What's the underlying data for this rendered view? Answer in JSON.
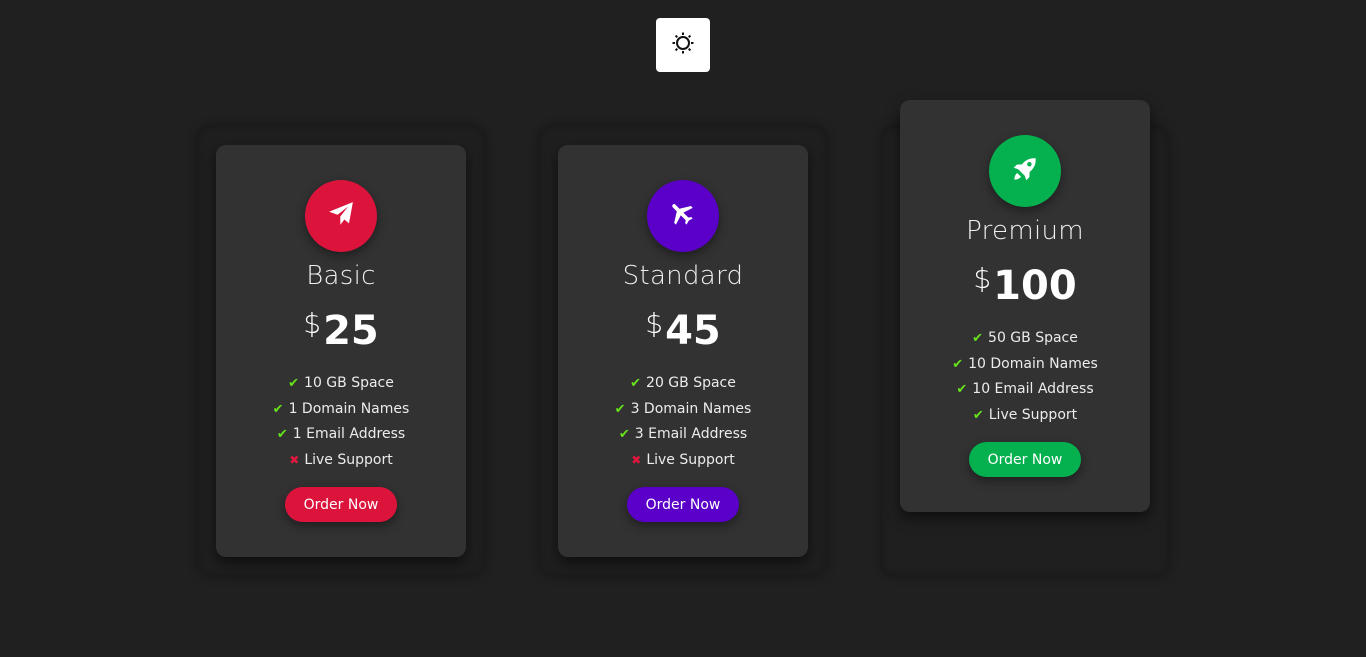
{
  "theme_toggle": {
    "icon": "sun-icon"
  },
  "colors": {
    "background": "#202020",
    "card": "#323232",
    "basic_accent": "#dc143c",
    "standard_accent": "#5a00c8",
    "premium_accent": "#05b14f",
    "check": "#66e31a",
    "cross": "#e0173e"
  },
  "plans": [
    {
      "name": "Basic",
      "currency": "$",
      "price": "25",
      "icon": "paper-plane-icon",
      "accent": "#dc143c",
      "button_label": "Order Now",
      "features": [
        {
          "text": "10 GB Space",
          "mark": "✔",
          "included": true
        },
        {
          "text": "1 Domain Names",
          "mark": "✔",
          "included": true
        },
        {
          "text": "1 Email Address",
          "mark": "✔",
          "included": true
        },
        {
          "text": "Live Support",
          "mark": "✖",
          "included": false
        }
      ]
    },
    {
      "name": "Standard",
      "currency": "$",
      "price": "45",
      "icon": "airplane-icon",
      "accent": "#5a00c8",
      "button_label": "Order Now",
      "features": [
        {
          "text": "20 GB Space",
          "mark": "✔",
          "included": true
        },
        {
          "text": "3 Domain Names",
          "mark": "✔",
          "included": true
        },
        {
          "text": "3 Email Address",
          "mark": "✔",
          "included": true
        },
        {
          "text": "Live Support",
          "mark": "✖",
          "included": false
        }
      ]
    },
    {
      "name": "Premium",
      "currency": "$",
      "price": "100",
      "icon": "rocket-icon",
      "accent": "#05b14f",
      "button_label": "Order Now",
      "features": [
        {
          "text": "50 GB Space",
          "mark": "✔",
          "included": true
        },
        {
          "text": "10 Domain Names",
          "mark": "✔",
          "included": true
        },
        {
          "text": "10 Email Address",
          "mark": "✔",
          "included": true
        },
        {
          "text": "Live Support",
          "mark": "✔",
          "included": true
        }
      ]
    }
  ]
}
